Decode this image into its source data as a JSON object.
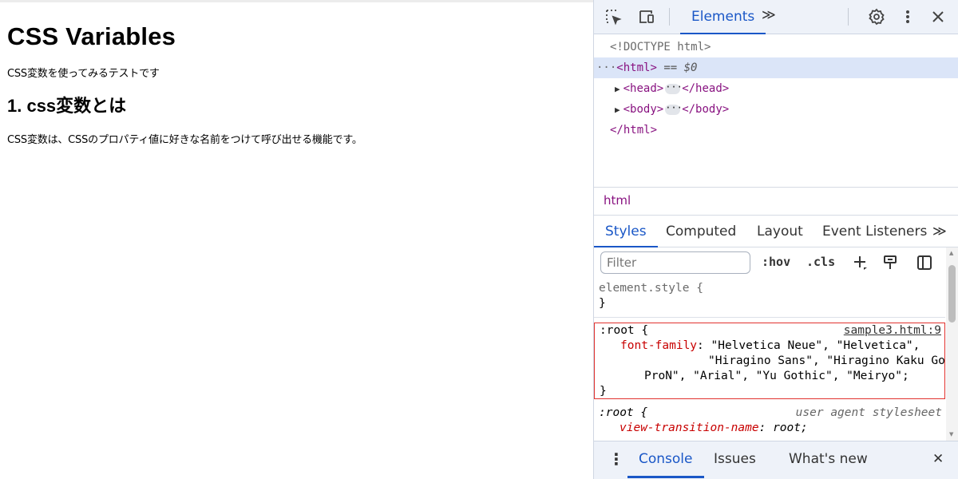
{
  "page": {
    "h1": "CSS Variables",
    "intro": "CSS変数を使ってみるテストです",
    "h2": "1. css変数とは",
    "desc": "CSS変数は、CSSのプロパティ値に好きな名前をつけて呼び出せる機能です。"
  },
  "devtools": {
    "toolbar": {
      "icons": [
        "inspect-icon",
        "device-toggle-icon",
        "settings-icon",
        "more-vert-icon",
        "close-icon"
      ],
      "active_tab": "Elements",
      "more_tabs": "≫"
    },
    "dom": {
      "doctype": "<!DOCTYPE html>",
      "html_open": "<html>",
      "html_eq": "== $0",
      "head_open": "<head>",
      "head_close": "</head>",
      "body_open": "<body>",
      "body_close": "</body>",
      "html_close": "</html>",
      "ellipsis": "···"
    },
    "breadcrumb": "html",
    "subtabs": [
      "Styles",
      "Computed",
      "Layout",
      "Event Listeners",
      "≫"
    ],
    "filter_placeholder": "Filter",
    "filter_buttons": {
      "hov": ":hov",
      "cls": ".cls"
    },
    "styles": {
      "element_style_open": "element.style {",
      "close_brace": "}",
      "root_selector": ":root {",
      "root_source": "sample3.html:9",
      "root_prop": "font-family",
      "root_value_l1": ": \"Helvetica Neue\", \"Helvetica\",",
      "root_value_l2": "\"Hiragino Sans\", \"Hiragino Kaku Gothic",
      "root_value_l3": "ProN\", \"Arial\", \"Yu Gothic\", \"Meiryo\";",
      "ua_selector": ":root {",
      "ua_source": "user agent stylesheet",
      "ua_prop": "view-transition-name",
      "ua_value": ": root;"
    },
    "drawer": {
      "menu_icon": "⋮",
      "tabs": [
        "Console",
        "Issues",
        "What's new"
      ],
      "close": "✕"
    },
    "colors": {
      "accent": "#1a57c7",
      "tag": "#881280",
      "highlight_box": "#e2322f"
    }
  }
}
